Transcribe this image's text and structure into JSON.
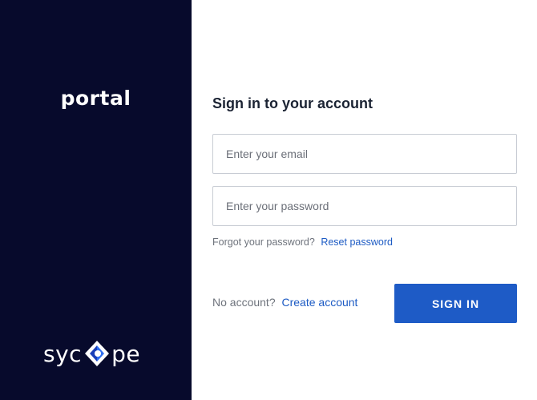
{
  "sidebar": {
    "app_name": "portal",
    "brand": {
      "prefix": "syc",
      "suffix": "pe",
      "logo_icon": "sycope-diamond-logo-icon"
    }
  },
  "login": {
    "heading": "Sign in to your account",
    "email_placeholder": "Enter your email",
    "email_value": "",
    "password_placeholder": "Enter your password",
    "password_value": "",
    "forgot_text": "Forgot your password?",
    "reset_link": "Reset password",
    "no_account_text": "No account?",
    "create_link": "Create account",
    "sign_in_label": "SIGN IN"
  },
  "colors": {
    "sidebar_bg": "#070a2c",
    "accent": "#1e5bc6",
    "link": "#1d5bc4",
    "logo_blue": "#2f6ef0"
  }
}
